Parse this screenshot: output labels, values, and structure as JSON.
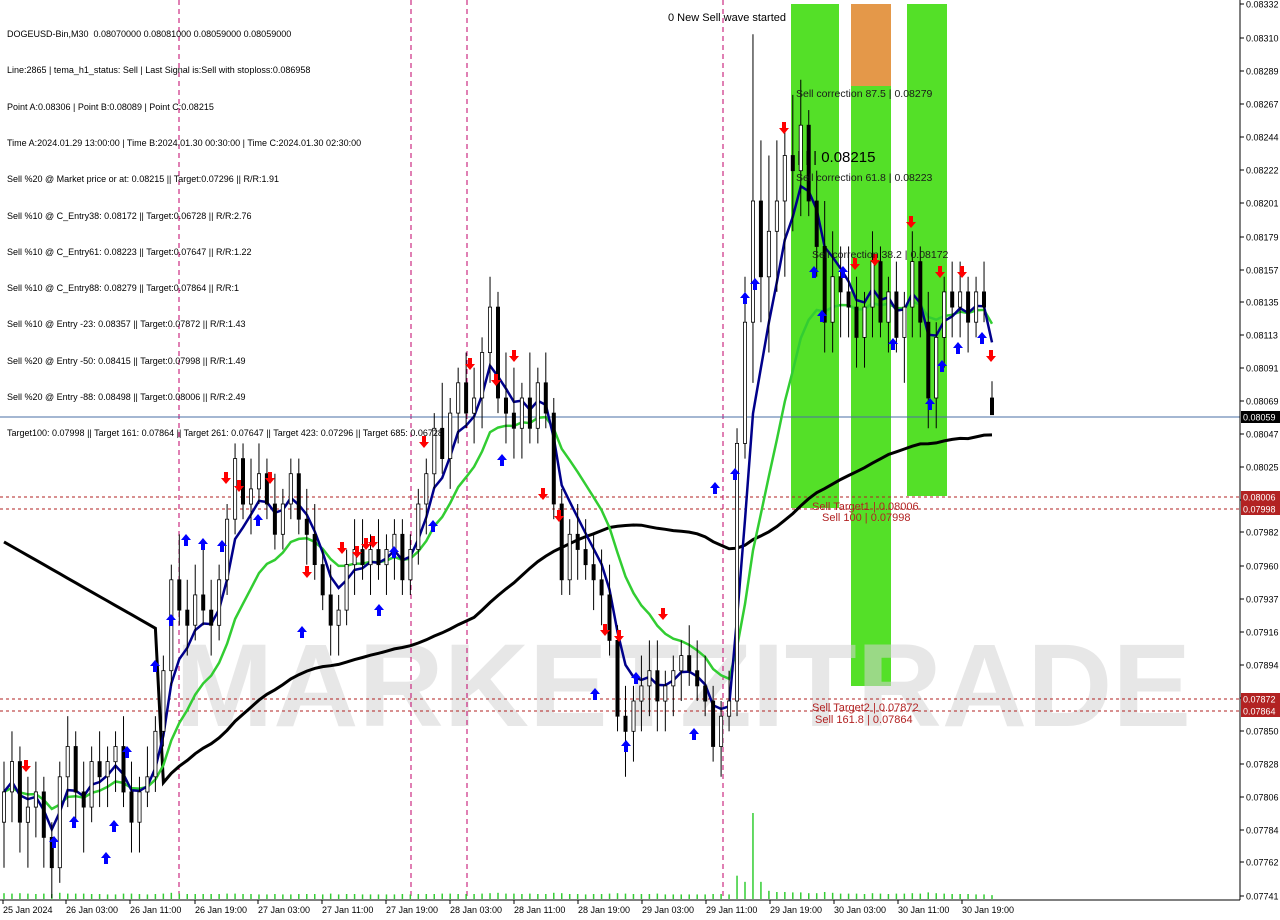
{
  "info_lines": [
    "DOGEUSD-Bin,M30  0.08070000 0.08081000 0.08059000 0.08059000",
    "Line:2865 | tema_h1_status: Sell | Last Signal is:Sell with stoploss:0.086958",
    "Point A:0.08306 | Point B:0.08089 | Point C:0.08215",
    "Time A:2024.01.29 13:00:00 | Time B:2024.01.30 00:30:00 | Time C:2024.01.30 02:30:00",
    "Sell %20 @ Market price or at: 0.08215 || Target:0.07296 || R/R:1.91",
    "Sell %10 @ C_Entry38: 0.08172 || Target:0.06728 || R/R:2.76",
    "Sell %10 @ C_Entry61: 0.08223 || Target:0.07647 || R/R:1.22",
    "Sell %10 @ C_Entry88: 0.08279 || Target:0.07864 || R/R:1",
    "Sell %10 @ Entry -23: 0.08357 || Target:0.07872 || R/R:1.43",
    "Sell %20 @ Entry -50: 0.08415 || Target:0.07998 || R/R:1.49",
    "Sell %20 @ Entry -88: 0.08498 || Target:0.08006 || R/R:2.49",
    "Target100: 0.07998 || Target 161: 0.07864 || Target 261: 0.07647 || Target 423: 0.07296 || Target 685: 0.06728"
  ],
  "wave_label": "0 New Sell wave started",
  "c_price_label": "| | | 0.08215",
  "zone_labels": {
    "corr875": "Sell correction 87.5 | 0.08279",
    "corr618": "Sell correction 61.8 | 0.08223",
    "corr382": "Sell correction 38.2 | 0.08172",
    "target1": "Sell Target1 | 0.08006",
    "sell100": "Sell 100 | 0.07998",
    "target2": "Sell Target2 | 0.07872",
    "sell1618": "Sell 161.8 | 0.07864"
  },
  "watermark": "MARKETZITRADE",
  "y_axis": {
    "min": 0.0774,
    "max": 0.0833,
    "ticks": [
      "0.08332",
      "0.08310",
      "0.08289",
      "0.08267",
      "0.08244",
      "0.08222",
      "0.08201",
      "0.08179",
      "0.08157",
      "0.08135",
      "0.08113",
      "0.08091",
      "0.08069",
      "0.08047",
      "0.08025",
      "0.08003",
      "0.07982",
      "0.07960",
      "0.07937",
      "0.07916",
      "0.07894",
      "0.07872",
      "0.07850",
      "0.07828",
      "0.07806",
      "0.07784",
      "0.07762",
      "0.07741"
    ]
  },
  "price_tags": {
    "current": "0.08059",
    "target1": "0.08006",
    "sell100": "0.07998",
    "target2": "0.07872",
    "sell1618": "0.07864"
  },
  "x_axis": {
    "labels": [
      "25 Jan 2024",
      "26 Jan 03:00",
      "26 Jan 11:00",
      "26 Jan 19:00",
      "27 Jan 03:00",
      "27 Jan 11:00",
      "27 Jan 19:00",
      "28 Jan 03:00",
      "28 Jan 11:00",
      "28 Jan 19:00",
      "29 Jan 03:00",
      "29 Jan 11:00",
      "29 Jan 19:00",
      "30 Jan 03:00",
      "30 Jan 11:00",
      "30 Jan 19:00"
    ]
  },
  "colors": {
    "bull": "#000000",
    "bear": "#000000",
    "up_arrow": "#0000ff",
    "down_arrow": "#ff0000",
    "ma_blue": "#00008b",
    "ma_green": "#32cd32",
    "ma_black": "#000000",
    "zone_green": "#3cdc0a",
    "zone_orange": "#e08a30",
    "level_red": "#b22222",
    "session_line": "#c0006a",
    "current_line": "#4a6fa5",
    "volume": "#32cd32",
    "watermark": "#d0d0d0"
  },
  "chart_data": {
    "type": "candlestick",
    "symbol": "DOGEUSD-Bin",
    "timeframe": "M30",
    "last": {
      "open": 0.0807,
      "high": 0.08081,
      "low": 0.08059,
      "close": 0.08059
    },
    "ohlc": [
      [
        0.0779,
        0.0783,
        0.0776,
        0.0781
      ],
      [
        0.0781,
        0.0785,
        0.0779,
        0.0783
      ],
      [
        0.0783,
        0.0784,
        0.0777,
        0.0779
      ],
      [
        0.0779,
        0.0782,
        0.0776,
        0.078
      ],
      [
        0.078,
        0.0783,
        0.0778,
        0.0781
      ],
      [
        0.0781,
        0.0782,
        0.0776,
        0.0778
      ],
      [
        0.0778,
        0.0779,
        0.0774,
        0.0776
      ],
      [
        0.0776,
        0.0783,
        0.0775,
        0.0782
      ],
      [
        0.0782,
        0.0786,
        0.078,
        0.0784
      ],
      [
        0.0784,
        0.0785,
        0.0779,
        0.0781
      ],
      [
        0.0781,
        0.0783,
        0.0777,
        0.078
      ],
      [
        0.078,
        0.0784,
        0.0779,
        0.0783
      ],
      [
        0.0783,
        0.0785,
        0.078,
        0.0782
      ],
      [
        0.0782,
        0.0784,
        0.078,
        0.0783
      ],
      [
        0.0783,
        0.0785,
        0.0781,
        0.0784
      ],
      [
        0.0784,
        0.0786,
        0.078,
        0.0781
      ],
      [
        0.0781,
        0.0783,
        0.0777,
        0.0779
      ],
      [
        0.0779,
        0.0782,
        0.0777,
        0.0781
      ],
      [
        0.0781,
        0.0784,
        0.078,
        0.0782
      ],
      [
        0.0782,
        0.0786,
        0.0781,
        0.0785
      ],
      [
        0.0785,
        0.079,
        0.0784,
        0.0789
      ],
      [
        0.0789,
        0.0796,
        0.0788,
        0.0795
      ],
      [
        0.0795,
        0.0798,
        0.0792,
        0.0793
      ],
      [
        0.0793,
        0.0795,
        0.079,
        0.0792
      ],
      [
        0.0792,
        0.0796,
        0.0791,
        0.0794
      ],
      [
        0.0794,
        0.0797,
        0.0792,
        0.0793
      ],
      [
        0.0793,
        0.0795,
        0.079,
        0.0792
      ],
      [
        0.0792,
        0.0796,
        0.0791,
        0.0795
      ],
      [
        0.0795,
        0.08,
        0.0794,
        0.0799
      ],
      [
        0.0799,
        0.0804,
        0.0798,
        0.0803
      ],
      [
        0.0803,
        0.0804,
        0.0799,
        0.08
      ],
      [
        0.08,
        0.0803,
        0.0798,
        0.0801
      ],
      [
        0.0801,
        0.0804,
        0.08,
        0.0802
      ],
      [
        0.0802,
        0.0803,
        0.0799,
        0.08
      ],
      [
        0.08,
        0.0802,
        0.0797,
        0.0798
      ],
      [
        0.0798,
        0.0801,
        0.0797,
        0.08
      ],
      [
        0.08,
        0.0803,
        0.0799,
        0.0802
      ],
      [
        0.0802,
        0.0803,
        0.0798,
        0.0799
      ],
      [
        0.0799,
        0.0801,
        0.0796,
        0.0798
      ],
      [
        0.0798,
        0.08,
        0.0795,
        0.0796
      ],
      [
        0.0796,
        0.0797,
        0.0793,
        0.0794
      ],
      [
        0.0794,
        0.0796,
        0.079,
        0.0792
      ],
      [
        0.0792,
        0.0794,
        0.079,
        0.0793
      ],
      [
        0.0793,
        0.0797,
        0.0792,
        0.0796
      ],
      [
        0.0796,
        0.0799,
        0.0794,
        0.0797
      ],
      [
        0.0797,
        0.0799,
        0.0795,
        0.0796
      ],
      [
        0.0796,
        0.0798,
        0.0794,
        0.0797
      ],
      [
        0.0797,
        0.0799,
        0.0795,
        0.0796
      ],
      [
        0.0796,
        0.0798,
        0.0794,
        0.0797
      ],
      [
        0.0797,
        0.0799,
        0.0795,
        0.0798
      ],
      [
        0.0798,
        0.0799,
        0.0794,
        0.0795
      ],
      [
        0.0795,
        0.0798,
        0.0794,
        0.0797
      ],
      [
        0.0797,
        0.0801,
        0.0796,
        0.08
      ],
      [
        0.08,
        0.0803,
        0.0798,
        0.0802
      ],
      [
        0.0802,
        0.0806,
        0.0801,
        0.0805
      ],
      [
        0.0805,
        0.0808,
        0.0802,
        0.0803
      ],
      [
        0.0803,
        0.0807,
        0.0801,
        0.0806
      ],
      [
        0.0806,
        0.0809,
        0.0804,
        0.0808
      ],
      [
        0.0808,
        0.081,
        0.0805,
        0.0806
      ],
      [
        0.0806,
        0.0809,
        0.0804,
        0.0807
      ],
      [
        0.0807,
        0.0811,
        0.0805,
        0.081
      ],
      [
        0.081,
        0.0815,
        0.0808,
        0.0813
      ],
      [
        0.0813,
        0.0814,
        0.0806,
        0.0807
      ],
      [
        0.0807,
        0.081,
        0.0804,
        0.0806
      ],
      [
        0.0806,
        0.0809,
        0.0803,
        0.0805
      ],
      [
        0.0805,
        0.0808,
        0.0803,
        0.0807
      ],
      [
        0.0807,
        0.081,
        0.0804,
        0.0805
      ],
      [
        0.0805,
        0.0809,
        0.0804,
        0.0808
      ],
      [
        0.0808,
        0.081,
        0.0805,
        0.0806
      ],
      [
        0.0806,
        0.0807,
        0.0799,
        0.08
      ],
      [
        0.08,
        0.0801,
        0.0794,
        0.0795
      ],
      [
        0.0795,
        0.0799,
        0.0794,
        0.0798
      ],
      [
        0.0798,
        0.08,
        0.0795,
        0.0797
      ],
      [
        0.0797,
        0.0799,
        0.0795,
        0.0796
      ],
      [
        0.0796,
        0.0798,
        0.0793,
        0.0795
      ],
      [
        0.0795,
        0.0797,
        0.0792,
        0.0794
      ],
      [
        0.0794,
        0.0796,
        0.079,
        0.0791
      ],
      [
        0.0791,
        0.0792,
        0.0785,
        0.0786
      ],
      [
        0.0786,
        0.0788,
        0.0782,
        0.0785
      ],
      [
        0.0785,
        0.0788,
        0.0783,
        0.0787
      ],
      [
        0.0787,
        0.079,
        0.0785,
        0.0788
      ],
      [
        0.0788,
        0.0791,
        0.0786,
        0.0789
      ],
      [
        0.0789,
        0.0791,
        0.0785,
        0.0787
      ],
      [
        0.0787,
        0.0789,
        0.0785,
        0.0788
      ],
      [
        0.0788,
        0.079,
        0.0786,
        0.0789
      ],
      [
        0.0789,
        0.0791,
        0.0787,
        0.079
      ],
      [
        0.079,
        0.0792,
        0.0788,
        0.0789
      ],
      [
        0.0789,
        0.0791,
        0.0787,
        0.0788
      ],
      [
        0.0788,
        0.079,
        0.0786,
        0.0787
      ],
      [
        0.0787,
        0.0788,
        0.0783,
        0.0784
      ],
      [
        0.0784,
        0.0787,
        0.0782,
        0.0786
      ],
      [
        0.0786,
        0.0789,
        0.0785,
        0.0787
      ],
      [
        0.0787,
        0.0805,
        0.0786,
        0.0804
      ],
      [
        0.0804,
        0.0815,
        0.0803,
        0.0812
      ],
      [
        0.0812,
        0.0831,
        0.0808,
        0.082
      ],
      [
        0.082,
        0.0824,
        0.0812,
        0.0815
      ],
      [
        0.0815,
        0.0823,
        0.081,
        0.0818
      ],
      [
        0.0818,
        0.0824,
        0.0814,
        0.082
      ],
      [
        0.082,
        0.0825,
        0.0815,
        0.0823
      ],
      [
        0.0823,
        0.0827,
        0.0818,
        0.0822
      ],
      [
        0.0822,
        0.0828,
        0.0819,
        0.0825
      ],
      [
        0.0825,
        0.0826,
        0.0819,
        0.082
      ],
      [
        0.082,
        0.0822,
        0.0815,
        0.0817
      ],
      [
        0.0817,
        0.082,
        0.081,
        0.0812
      ],
      [
        0.0812,
        0.0818,
        0.081,
        0.0815
      ],
      [
        0.0815,
        0.0817,
        0.0811,
        0.0814
      ],
      [
        0.0814,
        0.0817,
        0.0811,
        0.0813
      ],
      [
        0.0813,
        0.0815,
        0.0809,
        0.0811
      ],
      [
        0.0811,
        0.0814,
        0.0809,
        0.0813
      ],
      [
        0.0813,
        0.0818,
        0.0811,
        0.0816
      ],
      [
        0.0816,
        0.0817,
        0.0811,
        0.0812
      ],
      [
        0.0812,
        0.0815,
        0.081,
        0.0814
      ],
      [
        0.0814,
        0.0816,
        0.081,
        0.0811
      ],
      [
        0.0811,
        0.0814,
        0.0808,
        0.0813
      ],
      [
        0.0813,
        0.0818,
        0.0811,
        0.0816
      ],
      [
        0.0816,
        0.0817,
        0.0811,
        0.0812
      ],
      [
        0.0812,
        0.0814,
        0.0805,
        0.0807
      ],
      [
        0.0807,
        0.0812,
        0.0805,
        0.0811
      ],
      [
        0.0811,
        0.0815,
        0.0809,
        0.0814
      ],
      [
        0.0814,
        0.0816,
        0.0811,
        0.0813
      ],
      [
        0.0813,
        0.0816,
        0.0811,
        0.0814
      ],
      [
        0.0814,
        0.0815,
        0.081,
        0.0812
      ],
      [
        0.0812,
        0.0815,
        0.0811,
        0.0814
      ],
      [
        0.0814,
        0.0816,
        0.0812,
        0.0813
      ],
      [
        0.0807,
        0.08081,
        0.08059,
        0.08059
      ]
    ]
  }
}
